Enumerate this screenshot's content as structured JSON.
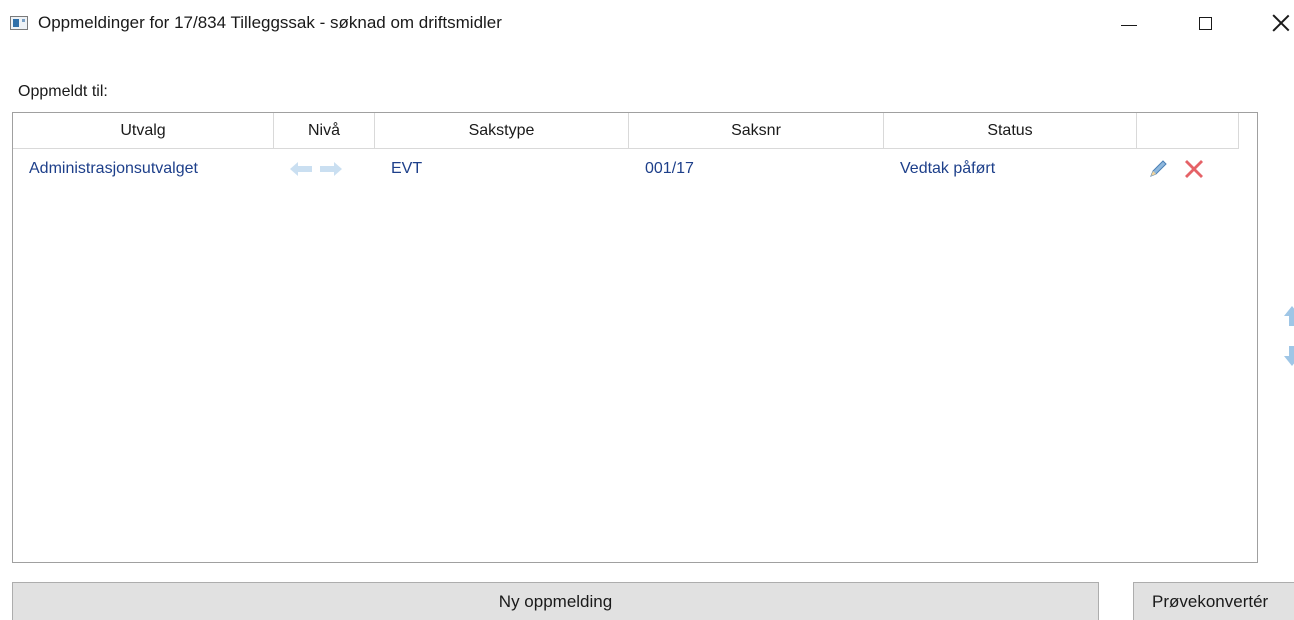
{
  "window": {
    "title": "Oppmeldinger for 17/834 Tilleggssak - søknad om driftsmidler",
    "controls": [
      "minimize-icon",
      "maximize-icon",
      "close-icon"
    ]
  },
  "section": {
    "label": "Oppmeldt til:"
  },
  "grid": {
    "columns": [
      "Utvalg",
      "Nivå",
      "Sakstype",
      "Saksnr",
      "Status",
      ""
    ],
    "rows": [
      {
        "utvalg": "Administrasjonsutvalget",
        "niva_icons": [
          "arrow-left-icon",
          "arrow-right-icon"
        ],
        "sakstype": "EVT",
        "saksnr": "001/17",
        "status": "Vedtak påført",
        "actions": [
          "edit-pencil-icon",
          "delete-x-icon"
        ]
      }
    ]
  },
  "side_controls": [
    "move-up-icon",
    "move-down-icon"
  ],
  "buttons": {
    "new": "Ny oppmelding",
    "convert": "Prøvekonvertér"
  },
  "colors": {
    "cell_text": "#1d3f8a",
    "button_bg": "#e1e1e1",
    "delete_red": "#e0474c",
    "arrow_blue": "#9fc6e6"
  }
}
